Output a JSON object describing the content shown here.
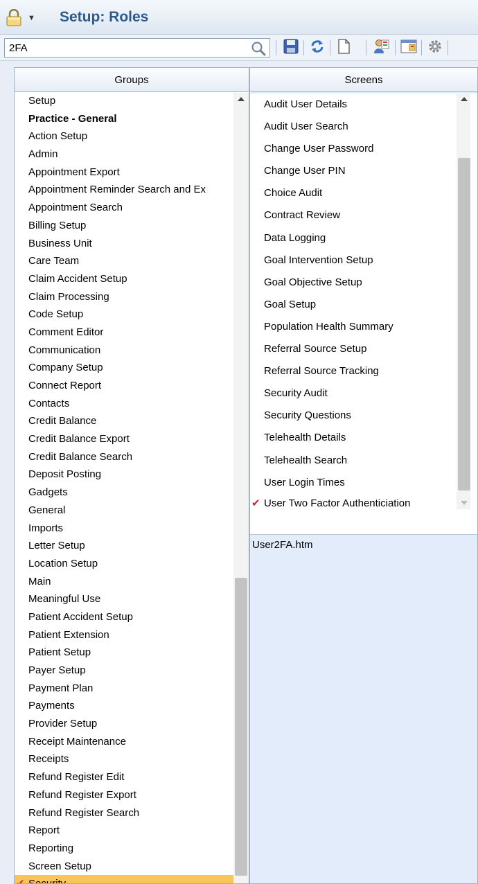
{
  "window": {
    "title": "Setup: Roles"
  },
  "search": {
    "value": "2FA",
    "placeholder": ""
  },
  "toolbar": {
    "icons": [
      "search-icon",
      "save-icon",
      "refresh-icon",
      "new-document-icon",
      "user-roles-icon",
      "window-settings-icon",
      "gear-icon"
    ]
  },
  "groups": {
    "header": "Groups",
    "items": [
      {
        "label": "Setup",
        "bold": false
      },
      {
        "label": "Practice - General",
        "bold": true
      },
      {
        "label": "Action Setup",
        "bold": false
      },
      {
        "label": "Admin",
        "bold": false
      },
      {
        "label": "Appointment Export",
        "bold": false
      },
      {
        "label": "Appointment Reminder Search and Ex",
        "bold": false
      },
      {
        "label": "Appointment Search",
        "bold": false
      },
      {
        "label": "Billing Setup",
        "bold": false
      },
      {
        "label": "Business Unit",
        "bold": false
      },
      {
        "label": "Care Team",
        "bold": false
      },
      {
        "label": "Claim Accident Setup",
        "bold": false
      },
      {
        "label": "Claim Processing",
        "bold": false
      },
      {
        "label": "Code Setup",
        "bold": false
      },
      {
        "label": "Comment Editor",
        "bold": false
      },
      {
        "label": "Communication",
        "bold": false
      },
      {
        "label": "Company Setup",
        "bold": false
      },
      {
        "label": "Connect Report",
        "bold": false
      },
      {
        "label": "Contacts",
        "bold": false
      },
      {
        "label": "Credit Balance",
        "bold": false
      },
      {
        "label": "Credit Balance Export",
        "bold": false
      },
      {
        "label": "Credit Balance Search",
        "bold": false
      },
      {
        "label": "Deposit Posting",
        "bold": false
      },
      {
        "label": "Gadgets",
        "bold": false
      },
      {
        "label": "General",
        "bold": false
      },
      {
        "label": "Imports",
        "bold": false
      },
      {
        "label": "Letter Setup",
        "bold": false
      },
      {
        "label": "Location Setup",
        "bold": false
      },
      {
        "label": "Main",
        "bold": false
      },
      {
        "label": "Meaningful Use",
        "bold": false
      },
      {
        "label": "Patient Accident Setup",
        "bold": false
      },
      {
        "label": "Patient Extension",
        "bold": false
      },
      {
        "label": "Patient Setup",
        "bold": false
      },
      {
        "label": "Payer Setup",
        "bold": false
      },
      {
        "label": "Payment Plan",
        "bold": false
      },
      {
        "label": "Payments",
        "bold": false
      },
      {
        "label": "Provider Setup",
        "bold": false
      },
      {
        "label": "Receipt Maintenance",
        "bold": false
      },
      {
        "label": "Receipts",
        "bold": false
      },
      {
        "label": "Refund Register Edit",
        "bold": false
      },
      {
        "label": "Refund Register Export",
        "bold": false
      },
      {
        "label": "Refund Register Search",
        "bold": false
      },
      {
        "label": "Report",
        "bold": false
      },
      {
        "label": "Reporting",
        "bold": false
      },
      {
        "label": "Screen Setup",
        "bold": false
      },
      {
        "label": "Security",
        "bold": false,
        "selected": true,
        "checked": true
      }
    ],
    "scroll_position": 0.62
  },
  "screens": {
    "header": "Screens",
    "items": [
      {
        "label": "Audit User Details"
      },
      {
        "label": "Audit User Search"
      },
      {
        "label": "Change User Password"
      },
      {
        "label": "Change User PIN"
      },
      {
        "label": "Choice Audit"
      },
      {
        "label": "Contract Review"
      },
      {
        "label": "Data Logging"
      },
      {
        "label": "Goal Intervention Setup"
      },
      {
        "label": "Goal Objective Setup"
      },
      {
        "label": "Goal Setup"
      },
      {
        "label": "Population Health Summary"
      },
      {
        "label": "Referral Source Setup"
      },
      {
        "label": "Referral Source Tracking"
      },
      {
        "label": "Security Audit"
      },
      {
        "label": "Security Questions"
      },
      {
        "label": "Telehealth Details"
      },
      {
        "label": "Telehealth Search"
      },
      {
        "label": "User Login Times"
      },
      {
        "label": "User Two Factor Authenticiation",
        "checked": true
      }
    ],
    "selected_file": "User2FA.htm"
  },
  "colors": {
    "title_text": "#2b5c8f",
    "selected_row": "#f9c55a",
    "check_mark": "#c0262d",
    "detail_background": "#e2ecfa"
  }
}
